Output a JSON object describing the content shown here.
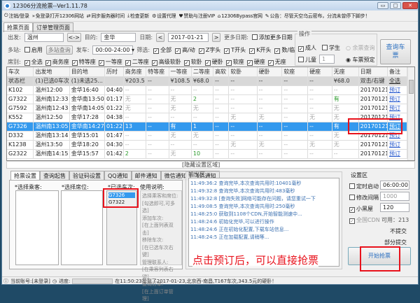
{
  "window": {
    "title": "12306分流抢票--Ver1.11.78",
    "min": "▭",
    "max": "□",
    "close": "✕"
  },
  "toolbar": [
    {
      "icon": "power-icon",
      "glyph": "⏻",
      "label": "注销/登录"
    },
    {
      "icon": "double-chevron-icon",
      "glyph": "»",
      "label": "免登录打开12306网站"
    },
    {
      "icon": "sync-icon",
      "glyph": "⇄",
      "label": "同步服务器时间"
    },
    {
      "icon": "download-icon",
      "glyph": "⤓",
      "label": "检查更新"
    },
    {
      "icon": "gear-icon",
      "glyph": "⚙",
      "label": "设置代理"
    },
    {
      "icon": "heart-icon",
      "glyph": "♥",
      "label": "赞助与注册VIP"
    },
    {
      "icon": "home-icon",
      "glyph": "⌂",
      "label": "12306Bypass官网"
    },
    {
      "icon": "pin-icon",
      "glyph": "✎",
      "label": "公告：尽管天空乌云密布，分流未曾停下脚步！"
    }
  ],
  "tabs": [
    "抢票页面",
    "订单管理页面"
  ],
  "form": {
    "from_label": "出发:",
    "from": "温州",
    "swap": "<->",
    "to_label": "目的:",
    "to": "金华",
    "date_label": "日期:",
    "date": "2017-01-21",
    "prev": "<",
    "next": ">",
    "more_dates_label": "更多日期:",
    "add_dates": "添加更多日期",
    "multi_label": "多站:",
    "enable": "启用",
    "multi_query": "多站查询",
    "depart_label": "发车:",
    "depart": "00:00-24:00",
    "filter_label": "筛选:",
    "filters": [
      "全部",
      "高/动",
      "Z字头",
      "T开头",
      "K开头",
      "数/临"
    ],
    "seat_label": "席别:",
    "seats": [
      "全选",
      "商务座",
      "特等座",
      "一等座",
      "二等座",
      "高级软卧",
      "软卧",
      "硬卧",
      "软座",
      "硬座",
      "无座"
    ]
  },
  "ops": {
    "title": "操作",
    "adult": "成人",
    "student": "学生",
    "child": "儿童",
    "child_count": "1",
    "remain_query": "余票查询",
    "reserve": "车票预定",
    "query_button": "查询车票"
  },
  "table": {
    "headers": [
      "车次",
      "出发地",
      "目的地",
      "历时",
      "商务座",
      "特等座",
      "一等座",
      "二等座",
      "高软",
      "软卧",
      "硬卧",
      "软座",
      "硬座",
      "无座",
      "日期",
      "备注"
    ],
    "status": [
      "状态栏",
      "(1)已选0车次",
      "(1)未选25...",
      "",
      "¥203.5",
      "--",
      "¥108.5",
      "¥68.0",
      "--",
      "--",
      "--",
      "--",
      "--",
      "¥68.0",
      "双击/右键",
      "全选"
    ],
    "rows": [
      [
        "K102",
        "温州12:00",
        "金华16:40",
        "04:40",
        "--",
        "--",
        "--",
        "--",
        "--",
        "--",
        "--",
        "--",
        "--",
        "--",
        "20170121",
        "预订"
      ],
      [
        "G7322",
        "温州南12:33",
        "金华南13:50",
        "01:17",
        "无",
        "--",
        "无",
        "2",
        "--",
        "--",
        "--",
        "--",
        "--",
        "有",
        "20170121",
        "预订"
      ],
      [
        "G7592",
        "温州南12:43",
        "金华南14:05",
        "01:22",
        "无",
        "--",
        "无",
        "无",
        "--",
        "--",
        "--",
        "--",
        "--",
        "无",
        "20170121",
        "预订"
      ],
      [
        "K552",
        "温州12:50",
        "金华17:28",
        "04:38",
        "--",
        "--",
        "--",
        "--",
        "--",
        "无",
        "无",
        "--",
        "无",
        "无",
        "20170121",
        "预订"
      ],
      [
        "G7326",
        "温州南13:05",
        "金华南14:27",
        "01:22",
        "13",
        "--",
        "有",
        "1",
        "--",
        "--",
        "--",
        "--",
        "--",
        "有",
        "20170121",
        "预订"
      ],
      [
        "D332",
        "温州南13:14",
        "金华15:01",
        "01:47",
        "--",
        "--",
        "无",
        "无",
        "--",
        "--",
        "--",
        "--",
        "--",
        "无",
        "20170121",
        "预订"
      ],
      [
        "K1238",
        "温州13:50",
        "金华18:20",
        "04:30",
        "--",
        "--",
        "--",
        "--",
        "--",
        "无",
        "无",
        "--",
        "无",
        "无",
        "20170121",
        "预订"
      ],
      [
        "G2322",
        "温州南14:15",
        "金华15:57",
        "01:42",
        "2",
        "--",
        "无",
        "10",
        "--",
        "--",
        "--",
        "--",
        "--",
        "--",
        "20170121",
        "预订"
      ]
    ],
    "selected_row": 4
  },
  "hide_bar": "[隐藏设置区域]",
  "settings_tabs": [
    "抢票设置",
    "查询起售",
    "验证码设置",
    "QQ通知",
    "邮件通知",
    "微信通知",
    "飞信通知"
  ],
  "passengers_label": "*选择乘客:",
  "seats_label": "*选择席位:",
  "trains_label": "*已选车次:",
  "selected_trains": [
    "G7326",
    "G7322"
  ],
  "help": {
    "title": "使用说明:",
    "lines": [
      "选择乘客和席位:",
      "[勾选即可,可多选]",
      "添加车次:",
      "[在上面列表双击]",
      "移除车次:",
      "[在已选车次右键]",
      "管理联系人:",
      "[在乘客列表右键]",
      "查询订单:",
      "[在上面订单管理]"
    ]
  },
  "output": {
    "title": "输出区",
    "lines": [
      "11:49:36:2  查询完毕,本次查询共用时:10401毫秒",
      "11:49:32:8  查询完毕,本次查询共用时:483毫秒",
      "11:49:32:8  [查询失败]网络可能存在问题，请您重试一下",
      "11:49:08:5  查询完毕,本次查询共用时:250毫秒",
      "11:48:25:0  获取到1108个CDN,开始智能测速中...",
      "11:48:24:6  初始化完毕,可以进行操作",
      "11:48:24:6  正在初始化配置,下载车站信息...",
      "11:48:24:5  正在加载配置,请稍等..."
    ]
  },
  "settings": {
    "title": "设置区",
    "timer": "定时启动",
    "timer_value": "06:00:00",
    "interval": "修改间隔",
    "interval_value": "1000",
    "blackroom": "小黑屋",
    "blackroom_value": "120",
    "cdn": "全国CDN",
    "cdn_avail": "可用：213",
    "no_submit": "不提交",
    "partial_submit": "部分提交",
    "start_button": "开始抢票"
  },
  "annotation": "点击预订后，可以直接抢票",
  "statusbar": {
    "account": "当前账号:[未登录]",
    "progress_label": "进度:",
    "progress": 0,
    "message": "在11:50:23抢到了2017-01-23,北京西-南昌,T167车次,343.5元的硬卧！"
  }
}
